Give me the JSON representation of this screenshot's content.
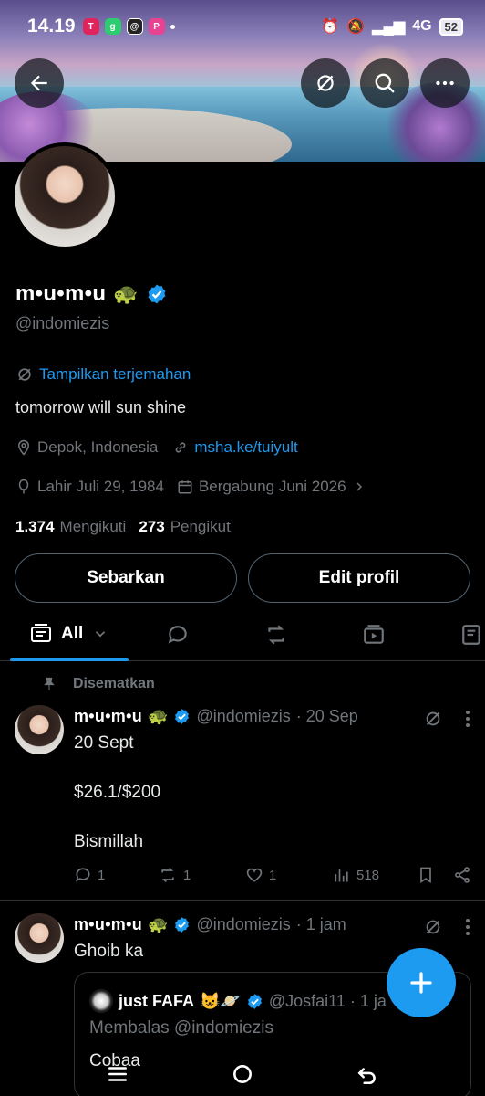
{
  "status": {
    "time": "14.19",
    "network": "4G",
    "battery": "52"
  },
  "profile": {
    "name": "m•u•m•u",
    "emoji": "🐢",
    "handle": "@indomiezis",
    "translate_label": "Tampilkan terjemahan",
    "bio": "tomorrow will sun shine",
    "location": "Depok, Indonesia",
    "website": "msha.ke/tuiyult",
    "birthday": "Lahir Juli 29, 1984",
    "joined": "Bergabung Juni 2026",
    "following_count": "1.374",
    "following_label": "Mengikuti",
    "followers_count": "273",
    "followers_label": "Pengikut"
  },
  "buttons": {
    "share": "Sebarkan",
    "edit": "Edit profil"
  },
  "tabs": {
    "all": "All"
  },
  "pinned_label": "Disematkan",
  "posts": [
    {
      "name": "m•u•m•u",
      "emoji": "🐢",
      "handle": "@indomiezis",
      "time": "· 20 Sep",
      "lines": [
        "20 Sept",
        "$26.1/$200",
        "Bismillah"
      ],
      "replies": "1",
      "reposts": "1",
      "likes": "1",
      "views": "518"
    },
    {
      "name": "m•u•m•u",
      "emoji": "🐢",
      "handle": "@indomiezis",
      "time": "· 1 jam",
      "text": "Ghoib ka",
      "quote": {
        "name": "just FAFA",
        "emoji": "😺🪐",
        "handle": "@Josfai11 · 1 ja",
        "reply_to": "Membalas @indomiezis",
        "text": "Cobaa"
      }
    }
  ],
  "colors": {
    "accent": "#1d9bf0",
    "muted": "#71767b",
    "background": "#000000"
  }
}
